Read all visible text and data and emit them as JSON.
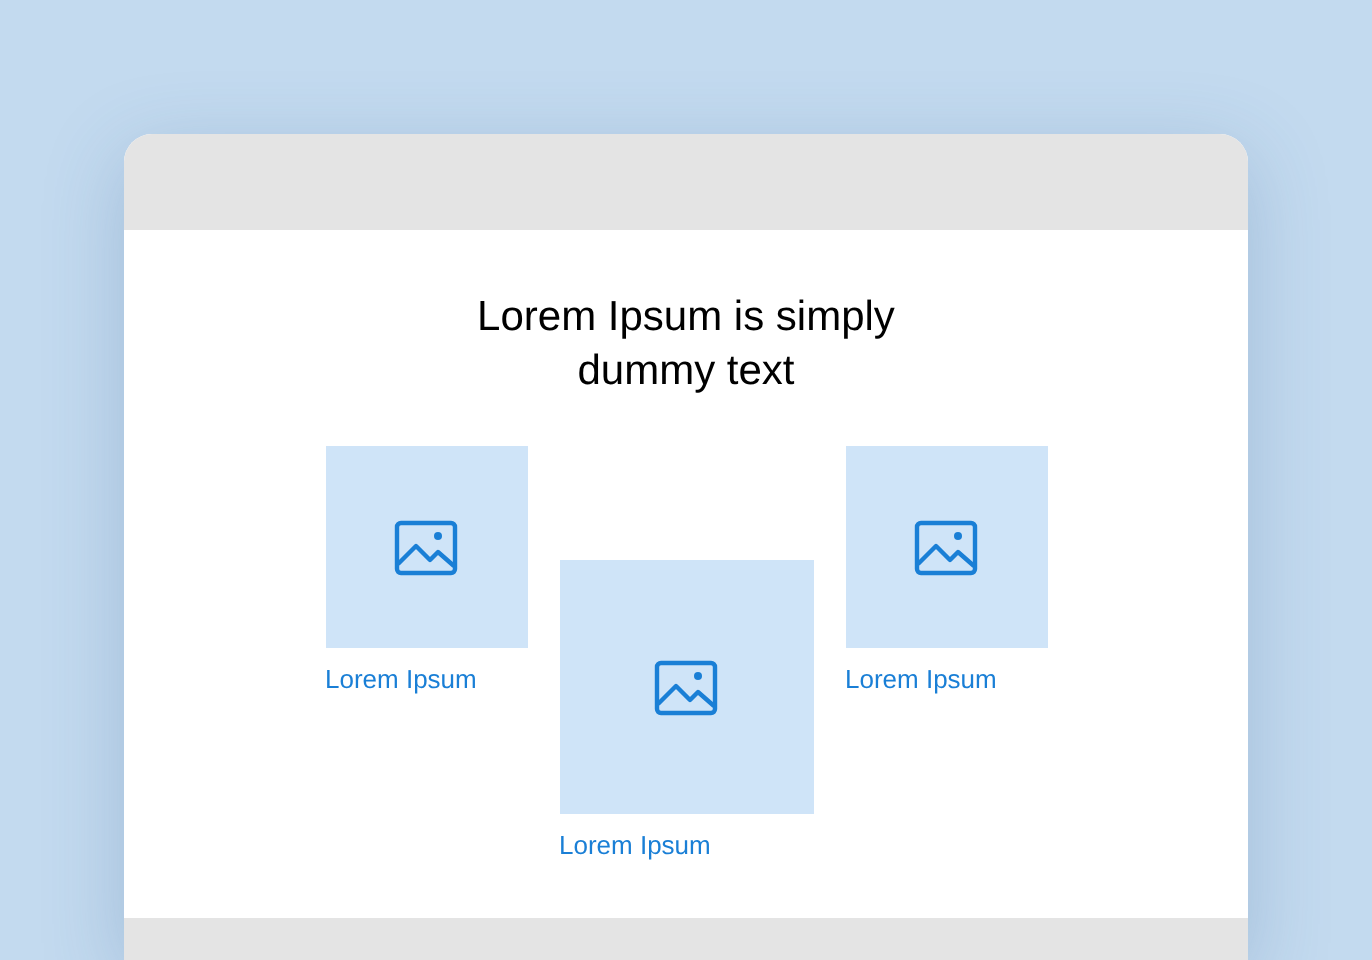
{
  "heading": "Lorem Ipsum is simply dummy text",
  "cards": [
    {
      "kind": "small",
      "label": "Lorem Ipsum"
    },
    {
      "kind": "large",
      "label": "Lorem Ipsum"
    },
    {
      "kind": "small",
      "label": "Lorem Ipsum"
    }
  ]
}
